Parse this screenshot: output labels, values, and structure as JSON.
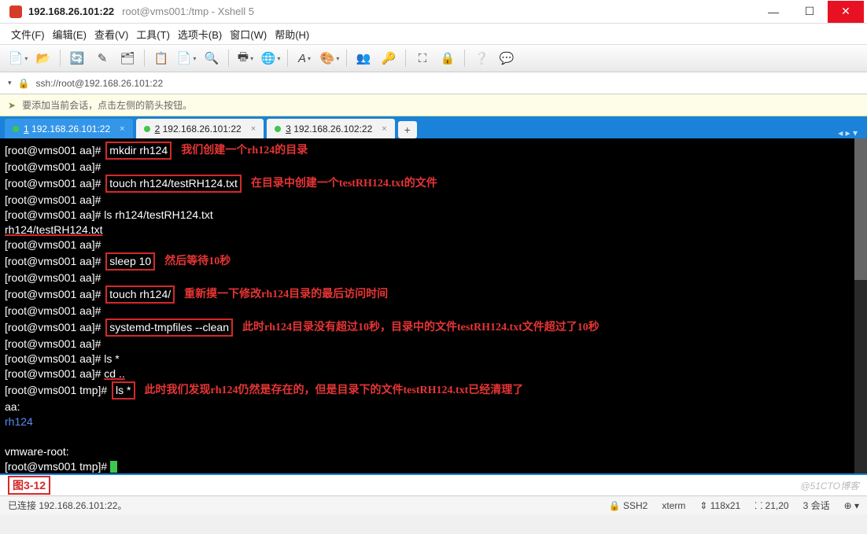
{
  "titlebar": {
    "main": "192.168.26.101:22",
    "sub": "root@vms001:/tmp - Xshell 5"
  },
  "menu": {
    "file": "文件(F)",
    "edit": "编辑(E)",
    "view": "查看(V)",
    "tools": "工具(T)",
    "tabs": "选项卡(B)",
    "window": "窗口(W)",
    "help": "帮助(H)"
  },
  "address": {
    "url": "ssh://root@192.168.26.101:22"
  },
  "hint": {
    "text": "要添加当前会话，点击左侧的箭头按钮。"
  },
  "tabs": [
    {
      "num": "1",
      "label": "192.168.26.101:22",
      "active": true
    },
    {
      "num": "2",
      "label": "192.168.26.101:22",
      "active": false
    },
    {
      "num": "3",
      "label": "192.168.26.102:22",
      "active": false
    }
  ],
  "addtab": "+",
  "term": {
    "p_aa": "[root@vms001 aa]# ",
    "p_tmp": "[root@vms001 tmp]# ",
    "cmd_mkdir": "mkdir rh124",
    "ann_mkdir": "我们创建一个rh124的目录",
    "cmd_touch_file": "touch rh124/testRH124.txt",
    "ann_touch_file": "在目录中创建一个testRH124.txt的文件",
    "cmd_ls_file": "ls rh124/testRH124.txt",
    "out_ls_file": "rh124/testRH124.txt",
    "cmd_sleep": "sleep 10",
    "ann_sleep": "然后等待10秒",
    "cmd_touch_dir": "touch rh124/",
    "ann_touch_dir": "重新摸一下修改rh124目录的最后访问时间",
    "cmd_clean": "systemd-tmpfiles --clean",
    "ann_clean": "此时rh124目录没有超过10秒，目录中的文件testRH124.txt文件超过了10秒",
    "cmd_ls_star": "ls *",
    "cmd_cd": "cd ..",
    "cmd_ls_star2": "ls *",
    "ann_ls_star2": "此时我们发现rh124仍然是存在的，但是目录下的文件testRH124.txt已经清理了",
    "out_aa": "aa:",
    "out_rh124": "rh124",
    "out_vmware": "vmware-root:"
  },
  "caption": {
    "label": "图3-12",
    "watermark": "@51CTO博客"
  },
  "status": {
    "conn": "已连接 192.168.26.101:22。",
    "proto": "SSH2",
    "term": "xterm",
    "size": "118x21",
    "pos": "21,20",
    "sessions": "3 会话"
  }
}
